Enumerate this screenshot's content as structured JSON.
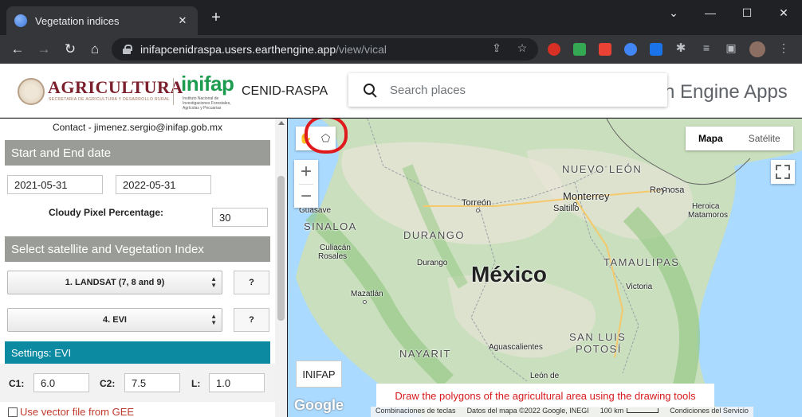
{
  "browser": {
    "tab_title": "Vegetation indices",
    "tab_close": "✕",
    "new_tab": "+",
    "url_host": "inifapcenidraspa.users.earthengine.app",
    "url_path": "/view/vical",
    "window_controls": [
      "⌄",
      "—",
      "☐",
      "✕"
    ],
    "nav": {
      "back": "←",
      "forward": "→",
      "reload": "↻",
      "home": "⌂"
    }
  },
  "header": {
    "agri_title": "AGRICULTURA",
    "agri_subtitle": "SECRETARÍA DE AGRICULTURA Y DESARROLLO RURAL",
    "inifap_logo": "inifap",
    "inifap_subtitle": "Instituto Nacional de Investigaciones Forestales, Agrícolas y Pecuarias",
    "cenid": "CENID-RASPA",
    "search_placeholder": "Search places",
    "earth_engine_apps": "h Engine Apps"
  },
  "panel": {
    "contact": "Contact - jimenez.sergio@inifap.gob.mx",
    "dates_header": "Start and End date",
    "start_date": "2021-05-31",
    "end_date": "2022-05-31",
    "cloudy_label": "Cloudy Pixel Percentage:",
    "cloudy_value": "30",
    "satellite_header": "Select satellite and Vegetation Index",
    "satellite_select": "1. LANDSAT (7, 8 and 9)",
    "index_select": "4. EVI",
    "help_label": "?",
    "settings_header": "Settings: EVI",
    "c1_label": "C1:",
    "c1_value": "6.0",
    "c2_label": "C2:",
    "c2_value": "7.5",
    "l_label": "L:",
    "l_value": "1.0",
    "vector_label": "Use vector file from GEE"
  },
  "map": {
    "map_type_options": [
      "Mapa",
      "Satélite"
    ],
    "selected_map_type": "Mapa",
    "country_label": "México",
    "state_labels": [
      "NUEVO LEÓN",
      "SINALOA",
      "DURANGO",
      "TAMAULIPAS",
      "SAN LUIS",
      "POTOSÍ",
      "NAYARIT"
    ],
    "city_labels": [
      "Monterrey",
      "Reynosa",
      "Heroica",
      "Matamoros",
      "Torreón",
      "Saltillo",
      "Guasave",
      "Culiacán",
      "Rosales",
      "Durango",
      "Mazatlán",
      "Victoria",
      "Aguascalientes",
      "León de"
    ],
    "inifap_button": "INIFAP",
    "draw_message": "Draw the polygons of the agricultural area using the drawing tools",
    "google_logo": "Google",
    "attribution": [
      "Combinaciones de teclas",
      "Datos del mapa ©2022 Google, INEGI",
      "100 km",
      "Condiciones del Servicio"
    ],
    "zoom_in": "+",
    "zoom_out": "−"
  },
  "colors": {
    "section_gray": "#9a9d97",
    "section_teal": "#0b8aa2",
    "draw_message_red": "#d6191c",
    "highlight_circle_red": "#e0191d",
    "agri_maroon": "#7a1f2b",
    "inifap_green": "#1d9b4e"
  }
}
